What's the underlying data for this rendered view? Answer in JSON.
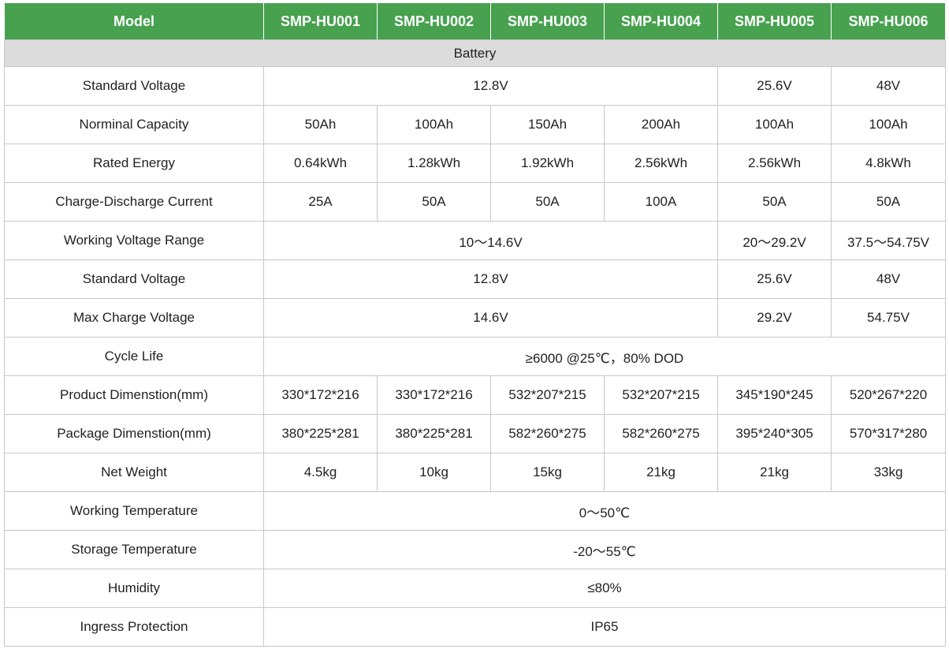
{
  "header": {
    "label": "Model",
    "models": [
      "SMP-HU001",
      "SMP-HU002",
      "SMP-HU003",
      "SMP-HU004",
      "SMP-HU005",
      "SMP-HU006"
    ]
  },
  "section_title": "Battery",
  "rows": [
    {
      "label": "Standard Voltage",
      "cells": [
        {
          "text": "12.8V",
          "span": 4
        },
        {
          "text": "25.6V",
          "span": 1
        },
        {
          "text": "48V",
          "span": 1
        }
      ]
    },
    {
      "label": "Norminal Capacity",
      "cells": [
        {
          "text": "50Ah",
          "span": 1
        },
        {
          "text": "100Ah",
          "span": 1
        },
        {
          "text": "150Ah",
          "span": 1
        },
        {
          "text": "200Ah",
          "span": 1
        },
        {
          "text": "100Ah",
          "span": 1
        },
        {
          "text": "100Ah",
          "span": 1
        }
      ]
    },
    {
      "label": "Rated Energy",
      "cells": [
        {
          "text": "0.64kWh",
          "span": 1
        },
        {
          "text": "1.28kWh",
          "span": 1
        },
        {
          "text": "1.92kWh",
          "span": 1
        },
        {
          "text": "2.56kWh",
          "span": 1
        },
        {
          "text": "2.56kWh",
          "span": 1
        },
        {
          "text": "4.8kWh",
          "span": 1
        }
      ]
    },
    {
      "label": "Charge-Discharge Current",
      "cells": [
        {
          "text": "25A",
          "span": 1
        },
        {
          "text": "50A",
          "span": 1
        },
        {
          "text": "50A",
          "span": 1
        },
        {
          "text": "100A",
          "span": 1
        },
        {
          "text": "50A",
          "span": 1
        },
        {
          "text": "50A",
          "span": 1
        }
      ]
    },
    {
      "label": "Working Voltage Range",
      "cells": [
        {
          "text": "10～14.6V",
          "span": 4
        },
        {
          "text": "20～29.2V",
          "span": 1
        },
        {
          "text": "37.5～54.75V",
          "span": 1
        }
      ]
    },
    {
      "label": "Standard Voltage",
      "cells": [
        {
          "text": "12.8V",
          "span": 4
        },
        {
          "text": "25.6V",
          "span": 1
        },
        {
          "text": "48V",
          "span": 1
        }
      ]
    },
    {
      "label": "Max Charge Voltage",
      "cells": [
        {
          "text": "14.6V",
          "span": 4
        },
        {
          "text": "29.2V",
          "span": 1
        },
        {
          "text": "54.75V",
          "span": 1
        }
      ]
    },
    {
      "label": "Cycle Life",
      "cells": [
        {
          "text": "≥6000 @25℃，80% DOD",
          "span": 6
        }
      ]
    },
    {
      "label": "Product Dimenstion(mm)",
      "cells": [
        {
          "text": "330*172*216",
          "span": 1
        },
        {
          "text": "330*172*216",
          "span": 1
        },
        {
          "text": "532*207*215",
          "span": 1
        },
        {
          "text": "532*207*215",
          "span": 1
        },
        {
          "text": "345*190*245",
          "span": 1
        },
        {
          "text": "520*267*220",
          "span": 1
        }
      ]
    },
    {
      "label": "Package Dimenstion(mm)",
      "cells": [
        {
          "text": "380*225*281",
          "span": 1
        },
        {
          "text": "380*225*281",
          "span": 1
        },
        {
          "text": "582*260*275",
          "span": 1
        },
        {
          "text": "582*260*275",
          "span": 1
        },
        {
          "text": "395*240*305",
          "span": 1
        },
        {
          "text": "570*317*280",
          "span": 1
        }
      ]
    },
    {
      "label": "Net Weight",
      "cells": [
        {
          "text": "4.5kg",
          "span": 1
        },
        {
          "text": "10kg",
          "span": 1
        },
        {
          "text": "15kg",
          "span": 1
        },
        {
          "text": "21kg",
          "span": 1
        },
        {
          "text": "21kg",
          "span": 1
        },
        {
          "text": "33kg",
          "span": 1
        }
      ]
    },
    {
      "label": "Working Temperature",
      "cells": [
        {
          "text": "0～50℃",
          "span": 6
        }
      ]
    },
    {
      "label": "Storage Temperature",
      "cells": [
        {
          "text": "-20～55℃",
          "span": 6
        }
      ]
    },
    {
      "label": "Humidity",
      "cells": [
        {
          "text": "≤80%",
          "span": 6
        }
      ]
    },
    {
      "label": "Ingress Protection",
      "cells": [
        {
          "text": "IP65",
          "span": 6
        }
      ]
    }
  ],
  "colors": {
    "header_bg": "#47a14f",
    "header_text": "#ffffff",
    "section_bg": "#dcdcdc",
    "border": "#c8c8c8"
  }
}
